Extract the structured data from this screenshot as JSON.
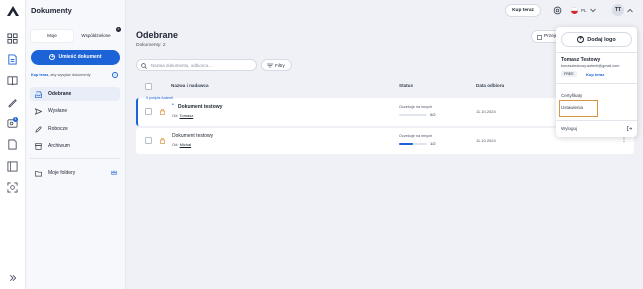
{
  "sidebar": {
    "title": "Dokumenty",
    "tabs": [
      "Moje",
      "Współdzielone"
    ],
    "tab_badge": "0",
    "upload_label": "Umieść dokument",
    "buy_link": "Kup teraz",
    "buy_note": ", aby wysyłać dokumenty",
    "items": [
      {
        "label": "Odebrane",
        "icon": "inbox-icon"
      },
      {
        "label": "Wysłane",
        "icon": "send-icon"
      },
      {
        "label": "Robocze",
        "icon": "pencil-icon"
      },
      {
        "label": "Archiwum",
        "icon": "archive-icon"
      }
    ],
    "folders_label": "Moje foldery",
    "rail_badge": "4"
  },
  "topbar": {
    "buy_button": "Kup teraz",
    "language": "PL",
    "avatar_initials": "TT",
    "accent": "#1b63d6"
  },
  "main": {
    "title": "Odebrane",
    "subtitle": "Dokumenty: 2",
    "search_placeholder": "Nazwa dokumentu, odbiorca...",
    "filters_label": "Filtry",
    "partial_button": "Przeje",
    "columns": {
      "name": "Nazwa i nadawca",
      "status": "Status",
      "date": "Data odbioru"
    },
    "rows": [
      {
        "badge": "0 podpis Autenti",
        "name": "Dokument testowy",
        "from_prefix": "Od:",
        "from": "Tomasz",
        "status": "Oczekuje na innych",
        "count": "0/2",
        "progress": 0,
        "date": "11.10.2024"
      },
      {
        "badge": "",
        "name": "Dokument testowy",
        "from_prefix": "Od:",
        "from": "Michał",
        "status": "Oczekuje na innych",
        "count": "1/2",
        "progress": 0.5,
        "date": "11.10.2024"
      }
    ]
  },
  "dropdown": {
    "add_logo": "Dodaj logo",
    "user_name": "Tomasz Testowy",
    "user_email": "tomasztestowy.autenti@gmail.com",
    "plan": "FREE",
    "buy": "Kup teraz",
    "items": [
      "Certyfikaty",
      "Ustawienia"
    ],
    "logout": "Wyloguj"
  }
}
